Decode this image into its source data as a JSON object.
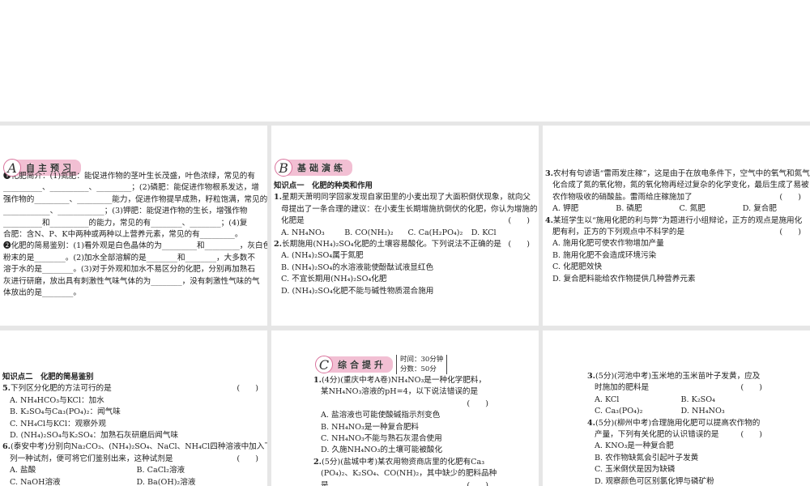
{
  "panels": [
    {
      "badge": {
        "letter": "A",
        "title": "自主预习"
      },
      "lines": [
        {
          "kind": "q",
          "t": "❶化肥简介：(1)氮肥：能促进作物的茎叶生长茂盛，叶色浓绿，常见的有"
        },
        {
          "kind": "plain",
          "t": "__________、__________、_________；(2)磷肥：能促进作物根系发达，增"
        },
        {
          "kind": "plain",
          "t": "强作物的_________、_________能力，促进作物提早成熟，籽粒饱满，常见的有"
        },
        {
          "kind": "plain",
          "t": "____________、____________；(3)钾肥：能促进作物的生长，增强作物"
        },
        {
          "kind": "plain",
          "t": "__________和__________的能力，常见的有________、________；(4)复"
        },
        {
          "kind": "plain",
          "t": "合肥：含N、P、K中两种或两种以上营养元素，常见的有_________。"
        },
        {
          "kind": "q",
          "t": "❷化肥的简易鉴别：(1)看外观是白色晶体的为_________和_________，灰白色"
        },
        {
          "kind": "plain",
          "t": "粉末的是________。(2)加水全部溶解的是________和________，大多数不"
        },
        {
          "kind": "plain",
          "t": "溶于水的是________。(3)对于外观和加水不易区分的化肥，分别再加熟石"
        },
        {
          "kind": "plain",
          "t": "灰进行研磨，放出具有刺激性气味气体的为________，没有刺激性气味的气"
        },
        {
          "kind": "plain",
          "t": "体放出的是________。"
        }
      ]
    },
    {
      "badge": {
        "letter": "B",
        "title": "基础演练"
      },
      "lines": [
        {
          "kind": "head",
          "t": "知识点一　化肥的种类和作用"
        },
        {
          "kind": "q",
          "n": "1.",
          "t": "星期天萧明同学回家发现自家田里的小麦出现了大面积倒伏现象，就向父"
        },
        {
          "kind": "cont",
          "t": "母提出了一条合理的建议：在小麦生长期增施抗倒伏的化肥，你认为增施的"
        },
        {
          "kind": "cont",
          "t": "化肥是",
          "bracket": "(　　)"
        },
        {
          "kind": "optrow",
          "opts": [
            "A. NH₄NO₃",
            "B. CO(NH₂)₂",
            "C. Ca(H₂PO₄)₂",
            "D. KCl"
          ]
        },
        {
          "kind": "q",
          "n": "2.",
          "t": "长期施用(NH₄)₂SO₄化肥的土壤容易酸化。下列说法不正确的是",
          "bracket": "(　　)"
        },
        {
          "kind": "opt",
          "t": "A. (NH₄)₂SO₄属于氮肥"
        },
        {
          "kind": "opt",
          "t": "B. (NH₄)₂SO₄的水溶液能使酚酞试液显红色"
        },
        {
          "kind": "opt",
          "t": "C. 不宜长期用(NH₄)₂SO₄化肥"
        },
        {
          "kind": "opt",
          "t": "D. (NH₄)₂SO₄化肥不能与碱性物质混合施用"
        }
      ]
    },
    {
      "lines": [
        {
          "kind": "q",
          "n": "3.",
          "t": "农村有句谚语“雷雨发庄稼”，这是由于在放电条件下，空气中的氧气和氮气"
        },
        {
          "kind": "cont",
          "t": "化合成了氮的氧化物，氮的氧化物再经过复杂的化学变化，最后生成了易被"
        },
        {
          "kind": "cont",
          "t": "农作物吸收的硝酸盐。雷雨给庄稼施加了",
          "bracket": "(　　)"
        },
        {
          "kind": "optrow",
          "opts": [
            "A. 钾肥",
            "B. 磷肥",
            "C. 氮肥",
            "D. 复合肥"
          ]
        },
        {
          "kind": "q",
          "n": "4.",
          "t": "某班学生以“施用化肥的利与弊”为题进行小组辩论，正方的观点是施用化"
        },
        {
          "kind": "cont",
          "t": "肥有利，正方的下列观点中不科学的是",
          "bracket": "(　　)"
        },
        {
          "kind": "opt",
          "t": "A. 施用化肥可使农作物增加产量"
        },
        {
          "kind": "opt",
          "t": "B. 施用化肥不会造成环境污染"
        },
        {
          "kind": "opt",
          "t": "C. 化肥肥效快"
        },
        {
          "kind": "opt",
          "t": "D. 复合肥料能给农作物提供几种营养元素"
        }
      ]
    },
    {
      "lines": [
        {
          "kind": "head",
          "t": "知识点二　化肥的简易鉴别"
        },
        {
          "kind": "q",
          "n": "5.",
          "t": "下列区分化肥的方法可行的是",
          "bracket": "(　　)"
        },
        {
          "kind": "opt",
          "t": "A. NH₄HCO₃与KCl：加水"
        },
        {
          "kind": "opt",
          "t": "B. K₂SO₄与Ca₃(PO₄)₂：闻气味"
        },
        {
          "kind": "opt",
          "t": "C. NH₄Cl与KCl：观察外观"
        },
        {
          "kind": "opt",
          "t": "D. (NH₄)₂SO₄与K₂SO₄：加熟石灰研磨后闻气味"
        },
        {
          "kind": "q",
          "n": "6.",
          "t": "(泰安中考)分别向Na₂CO₃、(NH₄)₂SO₄、NaCl、NH₄Cl四种溶液中加入下"
        },
        {
          "kind": "cont",
          "t": "列一种试剂，便可将它们鉴别出来，这种试剂是",
          "bracket": "(　　)"
        },
        {
          "kind": "optrow",
          "opts": [
            "A. 盐酸",
            "B. CaCl₂溶液"
          ]
        },
        {
          "kind": "optrow",
          "opts": [
            "C. NaOH溶液",
            "D. Ba(OH)₂溶液"
          ]
        }
      ]
    },
    {
      "badge": {
        "letter": "C",
        "title": "综合提升",
        "time": "时间：30分钟",
        "score": "分数：50分"
      },
      "lines": [
        {
          "kind": "q",
          "n": "1.",
          "t": "(4分)(重庆中考A卷)NH₄NO₃是一种化学肥料，"
        },
        {
          "kind": "cont",
          "t": "某NH₄NO₃溶液的pH=4，以下说法错误的是"
        },
        {
          "kind": "cont",
          "t": "",
          "bracket": "(　　)"
        },
        {
          "kind": "opt",
          "t": "A. 盐溶液也可能使酸碱指示剂变色"
        },
        {
          "kind": "opt",
          "t": "B. NH₄NO₃是一种复合肥料"
        },
        {
          "kind": "opt",
          "t": "C. NH₄NO₃不能与熟石灰混合使用"
        },
        {
          "kind": "opt",
          "t": "D. 久施NH₄NO₃的土壤可能被酸化"
        },
        {
          "kind": "q",
          "n": "2.",
          "t": "(5分)(盐城中考)某农用物资商店里的化肥有Ca₃"
        },
        {
          "kind": "cont",
          "t": "(PO₄)₂、K₂SO₄、CO(NH)₂，其中缺少的肥料品种"
        },
        {
          "kind": "cont",
          "t": "是",
          "bracket": "(　　)"
        }
      ]
    },
    {
      "lines": [
        {
          "kind": "q",
          "n": "3.",
          "t": "(5分)(河池中考)玉米地的玉米苗叶子发黄，应及"
        },
        {
          "kind": "cont",
          "t": "时施加的肥料是",
          "bracket": "(　　)"
        },
        {
          "kind": "optrow",
          "opts": [
            "A. KCl",
            "B. K₂SO₄"
          ]
        },
        {
          "kind": "optrow",
          "opts": [
            "C. Ca₃(PO₄)₂",
            "D. NH₄NO₃"
          ]
        },
        {
          "kind": "q",
          "n": "4.",
          "t": "(5分)(柳州中考)合理施用化肥可以提高农作物的"
        },
        {
          "kind": "cont",
          "t": "产量，下列有关化肥的认识错误的是",
          "bracket": "(　　)"
        },
        {
          "kind": "opt",
          "t": "A. KNO₃是一种复合肥"
        },
        {
          "kind": "opt",
          "t": "B. 农作物缺氮会引起叶子发黄"
        },
        {
          "kind": "opt",
          "t": "C. 玉米倒伏是因为缺磷"
        },
        {
          "kind": "opt",
          "t": "D. 观察颜色可区别氯化钾与磷矿粉"
        }
      ]
    }
  ]
}
